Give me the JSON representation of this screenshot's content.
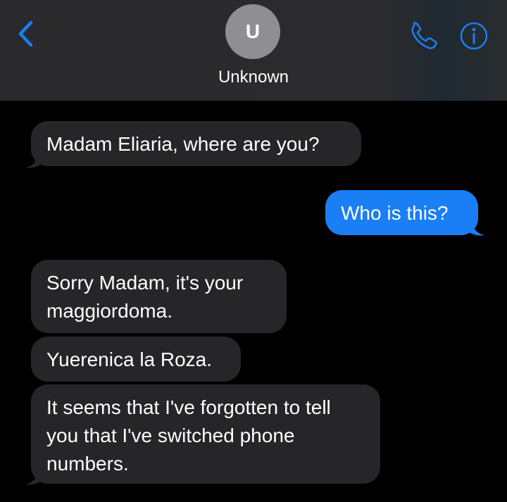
{
  "header": {
    "contact_initial": "U",
    "contact_name": "Unknown",
    "icons": {
      "back": "chevron-left-icon",
      "call": "phone-icon",
      "info": "info-icon"
    },
    "accent_color": "#1a7ef5"
  },
  "messages": [
    {
      "direction": "incoming",
      "text": "Madam Eliaria, where are you?"
    },
    {
      "direction": "outgoing",
      "text": "Who is this?"
    },
    {
      "direction": "incoming",
      "text": "Sorry Madam, it's your maggiordoma."
    },
    {
      "direction": "incoming",
      "text": "Yuerenica la Roza."
    },
    {
      "direction": "incoming",
      "text": "It seems that I've forgotten to tell you that I've switched phone numbers."
    }
  ]
}
